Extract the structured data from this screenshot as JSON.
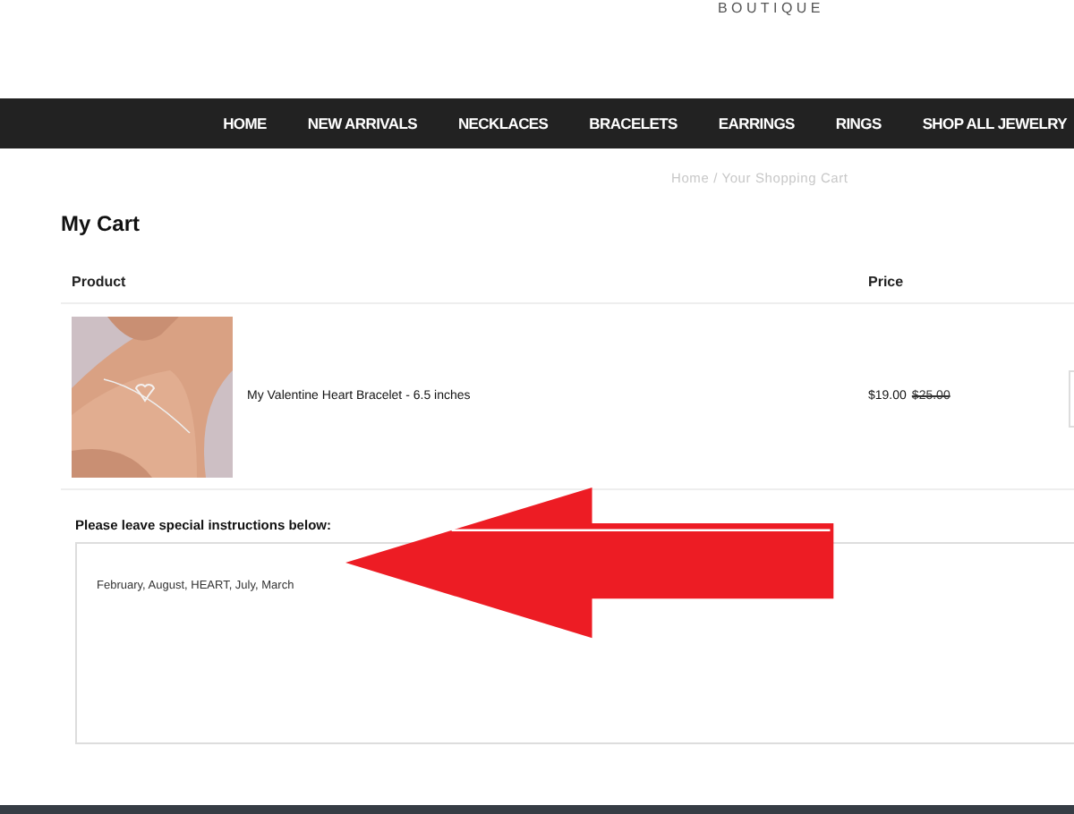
{
  "logo": {
    "text": "BOUTIQUE"
  },
  "nav": [
    {
      "label": "HOME"
    },
    {
      "label": "NEW ARRIVALS"
    },
    {
      "label": "NECKLACES"
    },
    {
      "label": "BRACELETS"
    },
    {
      "label": "EARRINGS"
    },
    {
      "label": "RINGS"
    },
    {
      "label": "SHOP ALL JEWELRY"
    }
  ],
  "breadcrumb": "Home / Your Shopping Cart",
  "page_title": "My Cart",
  "table": {
    "columns": [
      "Product",
      "Price"
    ],
    "rows": [
      {
        "name": "My Valentine Heart Bracelet - 6.5 inches",
        "price": "$19.00",
        "original_price": "$25.00"
      }
    ]
  },
  "instructions": {
    "label": "Please leave special instructions below:",
    "value": "February, August, HEART, July, March"
  }
}
